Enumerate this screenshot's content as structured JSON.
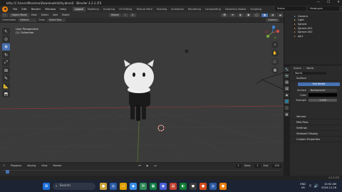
{
  "window": {
    "title": "kitty [C:\\Users\\Massimo\\Downloads\\kitty.blend] - Blender 4.2.3 LTS",
    "min": "—",
    "max": "☐",
    "close": "✕"
  },
  "menu": {
    "items": [
      "File",
      "Edit",
      "Render",
      "Window",
      "Help"
    ]
  },
  "workspaces": [
    "Layout",
    "Modeling",
    "Sculpting",
    "UV Editing",
    "Texture Paint",
    "Shading",
    "Animation",
    "Rendering",
    "Compositing",
    "Geometry Nodes",
    "Scripting"
  ],
  "active_workspace": "Layout",
  "scene_name": "Scene",
  "view_layer": "ViewLayer",
  "viewport_header": {
    "mode": "Object Mode",
    "menus": [
      "View",
      "Select",
      "Add",
      "Object"
    ],
    "transform": "Global"
  },
  "tool_settings": {
    "orientation_label": "Orientation:",
    "orientation": "Default",
    "drag_label": "Drag:",
    "drag": "Select Box",
    "options": "Options"
  },
  "viewport_info": {
    "view": "User Perspective",
    "collection": "(1) Collection"
  },
  "outliner": {
    "items": [
      "Camera",
      "Light",
      "Sphere",
      "Sphere.001",
      "Sphere.002",
      "ojo1"
    ]
  },
  "properties": {
    "scene_crumb": "Scene",
    "world_crumb": "World",
    "world_name": "World",
    "surface_header": "Surface",
    "use_nodes": "Use Nodes",
    "surface_label": "Surface",
    "surface_value": "Background",
    "color_label": "Color",
    "strength_label": "Strength",
    "strength_value": "1.000",
    "sections": [
      "Volume",
      "Mist Pass",
      "Settings",
      "Viewport Display",
      "Custom Properties"
    ]
  },
  "timeline": {
    "menus": [
      "Playback",
      "Keying",
      "View",
      "Marker"
    ],
    "current_frame": "1",
    "start_label": "Start",
    "start": "1",
    "end_label": "End",
    "end": "250"
  },
  "version": "4.2.3 LTS",
  "taskbar": {
    "search_placeholder": "Search",
    "lang": "ENG",
    "region": "US",
    "time": "10:52 AM",
    "date": "2024-12-16"
  },
  "colors": {
    "accent": "#4772b3",
    "x_axis": "#c84a4a",
    "y_axis": "#7ca33a",
    "z_axis": "#3e83d6"
  }
}
